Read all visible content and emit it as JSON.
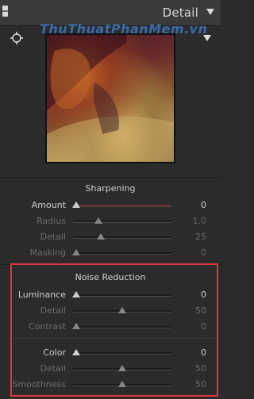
{
  "header": {
    "title": "Detail"
  },
  "watermark": "ThuThuatPhanMem.vn",
  "sharpening": {
    "title": "Sharpening",
    "rows": [
      {
        "label": "Amount",
        "value": "0",
        "fraction": 0.0,
        "active": true
      },
      {
        "label": "Radius",
        "value": "1.0",
        "fraction": 0.24,
        "active": false
      },
      {
        "label": "Detail",
        "value": "25",
        "fraction": 0.27,
        "active": false
      },
      {
        "label": "Masking",
        "value": "0",
        "fraction": 0.0,
        "active": false
      }
    ]
  },
  "noise_reduction": {
    "title": "Noise Reduction",
    "luminance_rows": [
      {
        "label": "Luminance",
        "value": "0",
        "fraction": 0.0,
        "active": true
      },
      {
        "label": "Detail",
        "value": "50",
        "fraction": 0.5,
        "active": false
      },
      {
        "label": "Contrast",
        "value": "0",
        "fraction": 0.0,
        "active": false
      }
    ],
    "color_rows": [
      {
        "label": "Color",
        "value": "0",
        "fraction": 0.0,
        "active": true
      },
      {
        "label": "Detail",
        "value": "50",
        "fraction": 0.5,
        "active": false
      },
      {
        "label": "Smoothness",
        "value": "50",
        "fraction": 0.5,
        "active": false
      }
    ]
  },
  "colors": {
    "highlight": "#e0373d",
    "amount_track": "#6b2a2a"
  }
}
